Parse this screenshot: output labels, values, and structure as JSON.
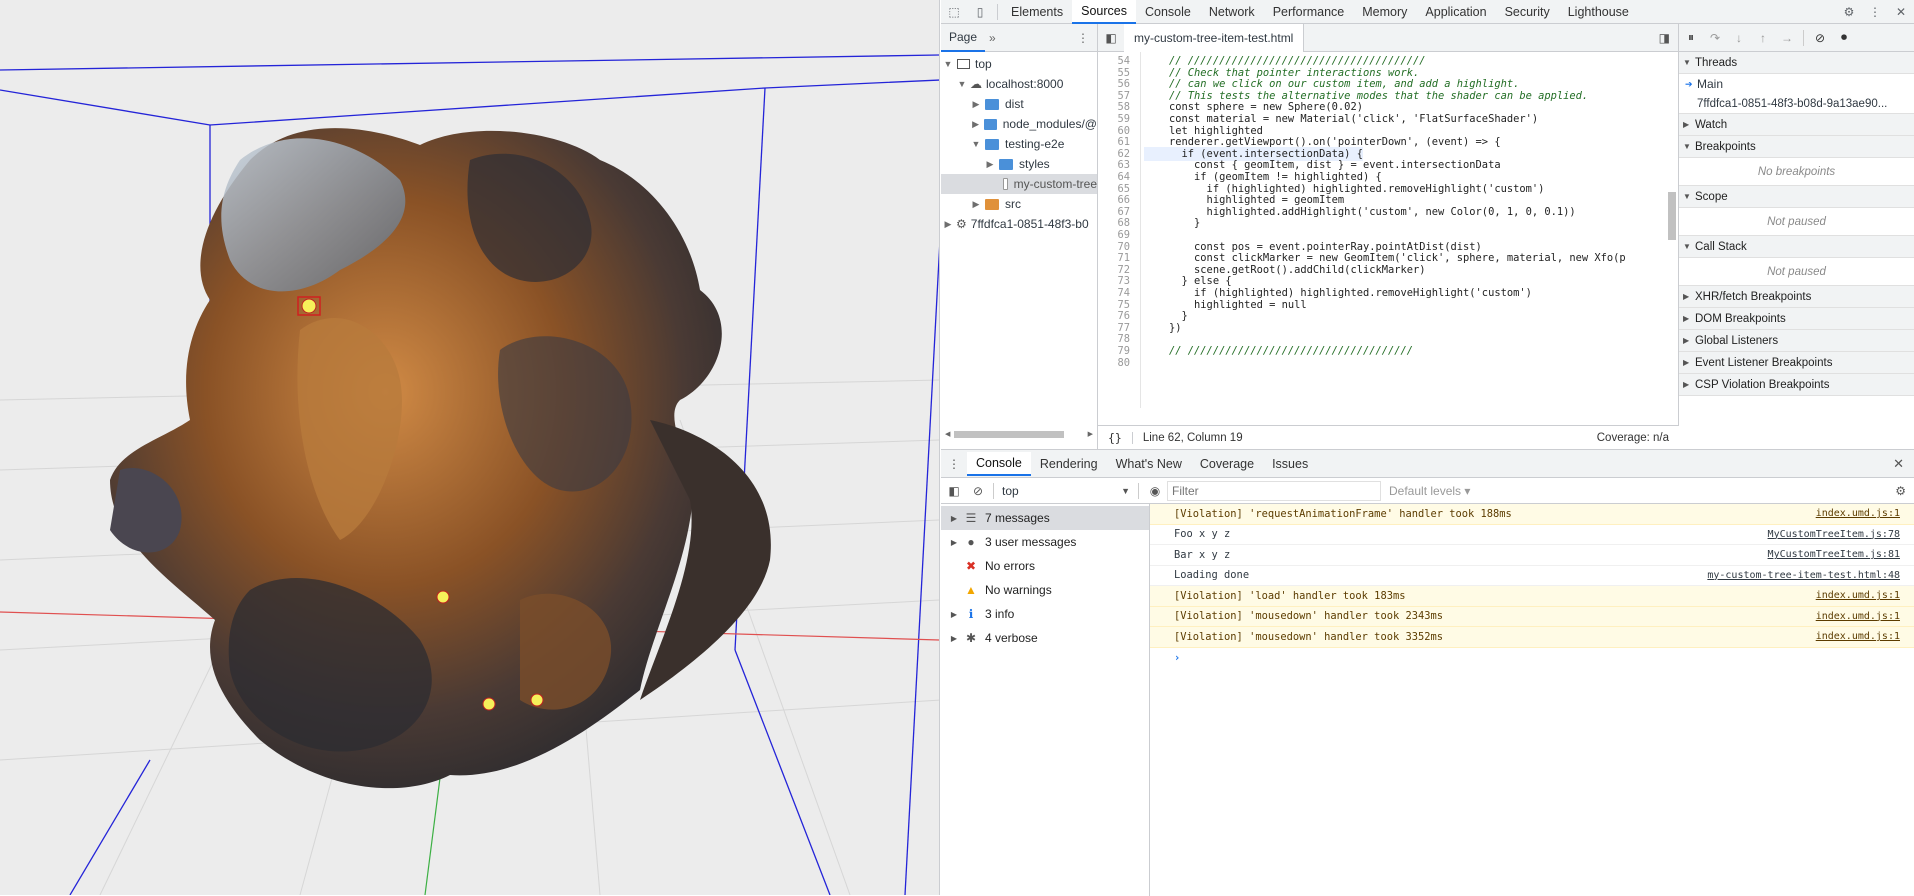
{
  "devtools": {
    "tabs": [
      "Elements",
      "Sources",
      "Console",
      "Network",
      "Performance",
      "Memory",
      "Application",
      "Security",
      "Lighthouse"
    ],
    "active_tab": "Sources"
  },
  "navigator": {
    "tab_label": "Page",
    "items": [
      {
        "label": "top"
      },
      {
        "label": "localhost:8000"
      },
      {
        "label": "dist"
      },
      {
        "label": "node_modules/@"
      },
      {
        "label": "testing-e2e"
      },
      {
        "label": "styles"
      },
      {
        "label": "my-custom-tree"
      },
      {
        "label": "src"
      },
      {
        "label": "7ffdfca1-0851-48f3-b0"
      }
    ]
  },
  "editor": {
    "file_tab": "my-custom-tree-item-test.html",
    "lines": [
      {
        "n": "54",
        "t": "    // //////////////////////////////////////"
      },
      {
        "n": "55",
        "t": "    // Check that pointer interactions work."
      },
      {
        "n": "56",
        "t": "    // can we click on our custom item, and add a highlight."
      },
      {
        "n": "57",
        "t": "    // This tests the alternative modes that the shader can be applied."
      },
      {
        "n": "58",
        "t": "    const sphere = new Sphere(0.02)"
      },
      {
        "n": "59",
        "t": "    const material = new Material('click', 'FlatSurfaceShader')"
      },
      {
        "n": "60",
        "t": "    let highlighted"
      },
      {
        "n": "61",
        "t": "    renderer.getViewport().on('pointerDown', (event) => {"
      },
      {
        "n": "62",
        "t": "      if (event.intersectionData) {"
      },
      {
        "n": "63",
        "t": "        const { geomItem, dist } = event.intersectionData"
      },
      {
        "n": "64",
        "t": "        if (geomItem != highlighted) {"
      },
      {
        "n": "65",
        "t": "          if (highlighted) highlighted.removeHighlight('custom')"
      },
      {
        "n": "66",
        "t": "          highlighted = geomItem"
      },
      {
        "n": "67",
        "t": "          highlighted.addHighlight('custom', new Color(0, 1, 0, 0.1))"
      },
      {
        "n": "68",
        "t": "        }"
      },
      {
        "n": "69",
        "t": ""
      },
      {
        "n": "70",
        "t": "        const pos = event.pointerRay.pointAtDist(dist)"
      },
      {
        "n": "71",
        "t": "        const clickMarker = new GeomItem('click', sphere, material, new Xfo(p"
      },
      {
        "n": "72",
        "t": "        scene.getRoot().addChild(clickMarker)"
      },
      {
        "n": "73",
        "t": "      } else {"
      },
      {
        "n": "74",
        "t": "        if (highlighted) highlighted.removeHighlight('custom')"
      },
      {
        "n": "75",
        "t": "        highlighted = null"
      },
      {
        "n": "76",
        "t": "      }"
      },
      {
        "n": "77",
        "t": "    })"
      },
      {
        "n": "78",
        "t": ""
      },
      {
        "n": "79",
        "t": "    // ////////////////////////////////////"
      },
      {
        "n": "80",
        "t": ""
      }
    ],
    "status_position": "Line 62, Column 19",
    "coverage": "Coverage: n/a"
  },
  "debugger": {
    "threads_label": "Threads",
    "main_label": "Main",
    "thread_id": "7ffdfca1-0851-48f3-b08d-9a13ae90...",
    "watch": "Watch",
    "breakpoints": "Breakpoints",
    "no_breakpoints": "No breakpoints",
    "scope": "Scope",
    "not_paused_1": "Not paused",
    "call_stack": "Call Stack",
    "not_paused_2": "Not paused",
    "xhr": "XHR/fetch Breakpoints",
    "dom": "DOM Breakpoints",
    "global": "Global Listeners",
    "event": "Event Listener Breakpoints",
    "csp": "CSP Violation Breakpoints"
  },
  "drawer": {
    "tabs": [
      "Console",
      "Rendering",
      "What's New",
      "Coverage",
      "Issues"
    ],
    "context": "top",
    "filter_placeholder": "Filter",
    "levels": "Default levels"
  },
  "console_sidebar": [
    {
      "label": "7 messages",
      "icon": "list-icon"
    },
    {
      "label": "3 user messages",
      "icon": "user-icon"
    },
    {
      "label": "No errors",
      "icon": "error-icon"
    },
    {
      "label": "No warnings",
      "icon": "warning-icon"
    },
    {
      "label": "3 info",
      "icon": "info-icon"
    },
    {
      "label": "4 verbose",
      "icon": "bug-icon"
    }
  ],
  "console_messages": [
    {
      "text": "[Violation] 'requestAnimationFrame' handler took 188ms",
      "src": "index.umd.js:1",
      "level": "warn"
    },
    {
      "text": "Foo x y z",
      "src": "MyCustomTreeItem.js:78",
      "level": "log"
    },
    {
      "text": "Bar x y z",
      "src": "MyCustomTreeItem.js:81",
      "level": "log"
    },
    {
      "text": "Loading done",
      "src": "my-custom-tree-item-test.html:48",
      "level": "log"
    },
    {
      "text": "[Violation] 'load' handler took 183ms",
      "src": "index.umd.js:1",
      "level": "warn"
    },
    {
      "text": "[Violation] 'mousedown' handler took 2343ms",
      "src": "index.umd.js:1",
      "level": "warn"
    },
    {
      "text": "[Violation] 'mousedown' handler took 3352ms",
      "src": "index.umd.js:1",
      "level": "warn"
    }
  ],
  "colors": {
    "accent": "#1a73e8",
    "warn_bg": "#fffbe5",
    "blob": "#8a5a2e",
    "axis_x": "#e05050",
    "axis_y": "#3cb043",
    "box": "#2020d0"
  }
}
